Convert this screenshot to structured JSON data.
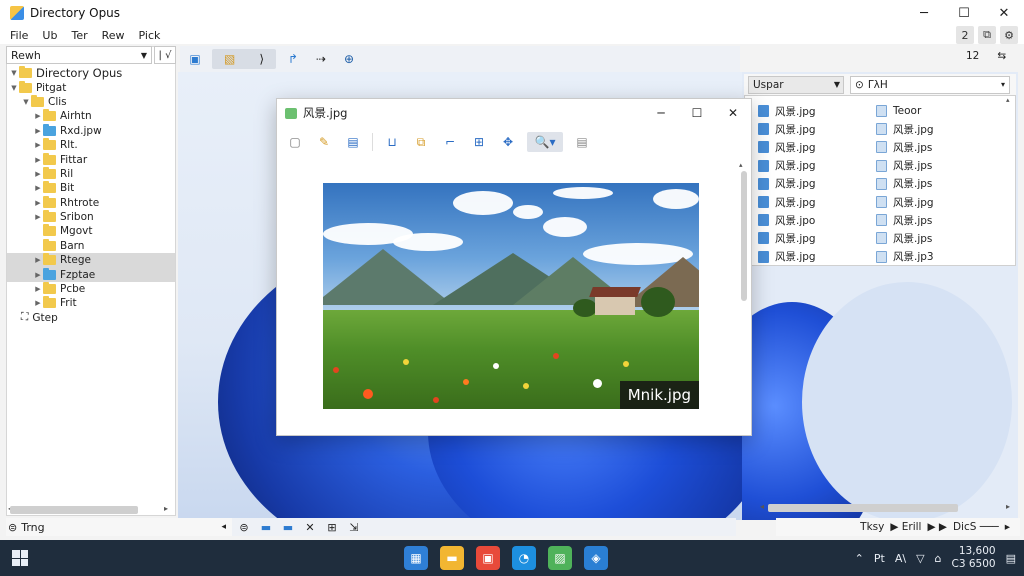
{
  "app": {
    "title": "Directory Opus",
    "window_buttons": [
      "─",
      "☐",
      "✕"
    ]
  },
  "menu": {
    "items": [
      "File",
      "Ub",
      "Ter",
      "Rew",
      "Pick"
    ],
    "right_icons": [
      "2",
      "⧉",
      "⚙"
    ]
  },
  "left": {
    "path_value": "Rewh",
    "path_side": "| √",
    "tree": [
      {
        "label": "Directory Opus",
        "indent": 0,
        "tw": "▼",
        "blue": false,
        "sel": false,
        "big": true
      },
      {
        "label": "Pitgat",
        "indent": 0,
        "tw": "▼",
        "blue": false,
        "sel": false
      },
      {
        "label": "Clis",
        "indent": 1,
        "tw": "▼",
        "blue": false,
        "sel": false
      },
      {
        "label": "Airhtn",
        "indent": 2,
        "tw": "▶",
        "blue": false,
        "sel": false
      },
      {
        "label": "Rxd.jpw",
        "indent": 2,
        "tw": "▶",
        "blue": true,
        "sel": false
      },
      {
        "label": "Rlt.",
        "indent": 2,
        "tw": "▶",
        "blue": false,
        "sel": false
      },
      {
        "label": "Fittar",
        "indent": 2,
        "tw": "▶",
        "blue": false,
        "sel": false
      },
      {
        "label": "Ril",
        "indent": 2,
        "tw": "▶",
        "blue": false,
        "sel": false
      },
      {
        "label": "Bit",
        "indent": 2,
        "tw": "▶",
        "blue": false,
        "sel": false
      },
      {
        "label": "Rhtrote",
        "indent": 2,
        "tw": "▶",
        "blue": false,
        "sel": false
      },
      {
        "label": "Sribon",
        "indent": 2,
        "tw": "▶",
        "blue": false,
        "sel": false
      },
      {
        "label": "Mgovt",
        "indent": 2,
        "tw": "",
        "blue": false,
        "sel": false
      },
      {
        "label": "Barn",
        "indent": 2,
        "tw": "",
        "blue": false,
        "sel": false
      },
      {
        "label": "Rtege",
        "indent": 2,
        "tw": "▶",
        "blue": false,
        "sel": true
      },
      {
        "label": "Fzptae",
        "indent": 2,
        "tw": "▶",
        "blue": true,
        "sel": true
      },
      {
        "label": "Pcbe",
        "indent": 2,
        "tw": "▶",
        "blue": false,
        "sel": false
      },
      {
        "label": "Frit",
        "indent": 2,
        "tw": "▶",
        "blue": false,
        "sel": false
      }
    ],
    "extra_item": "Gtep",
    "extra_icon": "⛶"
  },
  "toolstrip": {
    "buttons": [
      "▣",
      "⟩",
      "↱",
      "⇢",
      "⊕"
    ]
  },
  "viewer": {
    "title": "风景.jpg",
    "buttons": [
      "─",
      "☐",
      "✕"
    ],
    "tools": [
      "▢",
      "✎",
      "▤",
      "⊔",
      "⧉",
      "⌐",
      "⊞",
      "✥",
      "🔍▾",
      "▤"
    ],
    "photo_label": "Mnik.jpg"
  },
  "right": {
    "sort_value": "Uspar",
    "search_value": "ΓλΗ",
    "col1": [
      "风景.jpg",
      "风景.jpg",
      "风景.jpg",
      "风景.jpg",
      "风景.jpg",
      "风景.jpg",
      "风景.jpo",
      "风景.jpg",
      "风景.jpg"
    ],
    "col2": [
      "Teoor",
      "风景.jpg",
      "风景.jps",
      "风景.jps",
      "风景.jps",
      "风景.jpg",
      "风景.jps",
      "风景.jps",
      "风景.jp3"
    ],
    "footer": [
      "Tksy",
      "▶ Erill",
      "▶ ▶",
      "DicS ───",
      "▸"
    ],
    "right_header": [
      "12",
      "⇆"
    ]
  },
  "status": {
    "left_text": "Trng",
    "mini_tools": [
      "⊜",
      "▬",
      "▬",
      "✕",
      "⊞",
      "⇲"
    ]
  },
  "taskbar": {
    "apps": [
      {
        "name": "windows-app",
        "color": "#2f7fd6",
        "glyph": "▦"
      },
      {
        "name": "explorer-app",
        "color": "#f2b632",
        "glyph": "▬"
      },
      {
        "name": "store-app",
        "color": "#e84a3a",
        "glyph": "▣"
      },
      {
        "name": "edge-app",
        "color": "#1d8fe0",
        "glyph": "◔"
      },
      {
        "name": "photos-app",
        "color": "#4fb25a",
        "glyph": "▨"
      },
      {
        "name": "security-app",
        "color": "#2a7fd4",
        "glyph": "◈"
      }
    ],
    "tray": [
      "⌃",
      "Pt",
      "A\\",
      "▽",
      "⌂"
    ],
    "time": "13,600",
    "date": "C3 6500"
  }
}
